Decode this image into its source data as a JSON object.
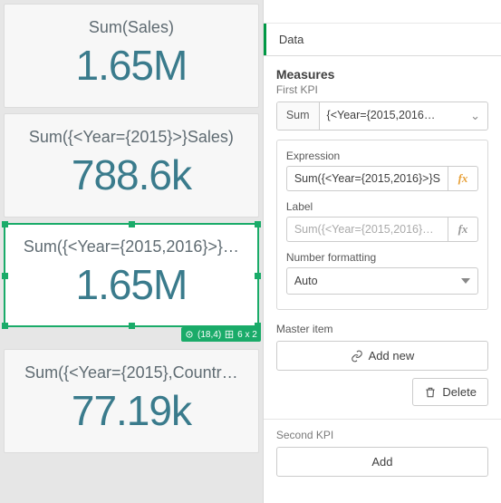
{
  "canvas": {
    "kpis": [
      {
        "label": "Sum(Sales)",
        "value": "1.65M",
        "selected": false
      },
      {
        "label": "Sum({<Year={2015}>}Sales)",
        "value": "788.6k",
        "selected": false
      },
      {
        "label": "Sum({<Year={2015,2016}>}…",
        "value": "1.65M",
        "selected": true
      },
      {
        "label": "Sum({<Year={2015},Countr…",
        "value": "77.19k",
        "selected": false
      }
    ],
    "selection_badge": {
      "pos": "(18,4)",
      "size": "6 x 2"
    }
  },
  "panel": {
    "tab_data": "Data",
    "measures_title": "Measures",
    "first_kpi_label": "First KPI",
    "agg": "Sum",
    "agg_expr": "{<Year={2015,2016…",
    "expression_label": "Expression",
    "expression_value": "Sum({<Year={2015,2016}>}S",
    "label_label": "Label",
    "label_placeholder": "Sum({<Year={2015,2016}…",
    "nf_label": "Number formatting",
    "nf_value": "Auto",
    "master_label": "Master item",
    "add_new": "Add new",
    "delete": "Delete",
    "second_kpi_label": "Second KPI",
    "add": "Add"
  }
}
